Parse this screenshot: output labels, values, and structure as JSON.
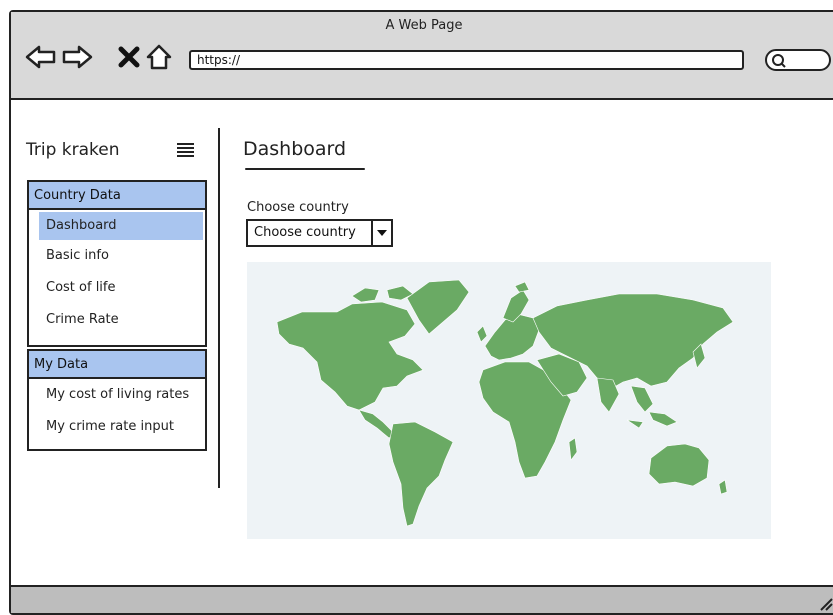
{
  "window": {
    "title": "A Web Page"
  },
  "browser": {
    "url": "https://",
    "icons": [
      "back-arrow-icon",
      "forward-arrow-icon",
      "close-x-icon",
      "home-icon",
      "search-icon"
    ]
  },
  "sidebar": {
    "brand": "Trip kraken",
    "groups": [
      {
        "header": "Country Data",
        "items": [
          {
            "label": "Dashboard",
            "selected": true
          },
          {
            "label": "Basic info"
          },
          {
            "label": "Cost of life"
          },
          {
            "label": "Crime Rate"
          }
        ]
      },
      {
        "header": "My Data",
        "items": [
          {
            "label": "My cost of living rates"
          },
          {
            "label": "My crime rate input"
          }
        ]
      }
    ]
  },
  "main": {
    "title": "Dashboard",
    "country_label": "Choose country",
    "country_select": "Choose country"
  },
  "colors": {
    "accent": "#a9c5ef",
    "map_land": "#6aaa64",
    "map_water": "#eef3f6",
    "titlebar": "#d9d9d9"
  }
}
